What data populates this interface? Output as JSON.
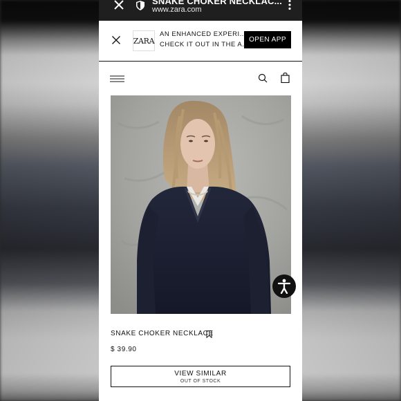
{
  "browser": {
    "title": "SNAKE CHOKER NECKLAC...",
    "url": "www.zara.com"
  },
  "app_banner": {
    "logo_text": "ZARA",
    "line1": "AN ENHANCED EXPERI...",
    "line2": "CHECK IT OUT IN THE A...",
    "open_button": "OPEN APP"
  },
  "header": {
    "icons": [
      "menu-icon",
      "search-icon",
      "shopping-bag-icon"
    ]
  },
  "product": {
    "name": "SNAKE CHOKER NECKLACE",
    "price": "$ 39.90",
    "image_alt": "Model wearing navy V-neck sweater and snake choker necklace"
  },
  "actions": {
    "view_similar": "VIEW SIMILAR",
    "stock_status": "OUT OF STOCK"
  },
  "colors": {
    "accent": "#000000",
    "tabbar": "#1f1f1f",
    "page": "#ffffff"
  }
}
